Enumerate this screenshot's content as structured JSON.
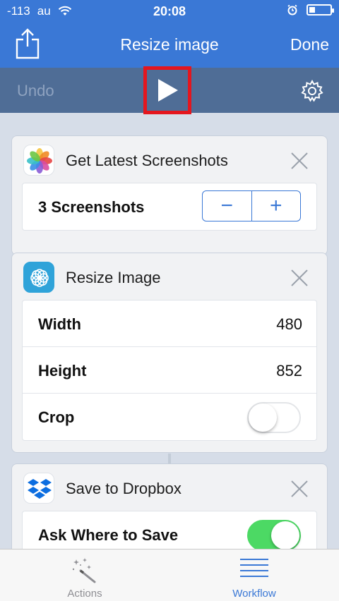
{
  "status_bar": {
    "signal": "-113",
    "carrier": "au",
    "time": "20:08"
  },
  "nav": {
    "title": "Resize image",
    "done_label": "Done"
  },
  "toolbar": {
    "undo_label": "Undo"
  },
  "actions": [
    {
      "title": "Get Latest Screenshots",
      "icon": "photos-icon",
      "rows": [
        {
          "label": "3 Screenshots",
          "control": "stepper"
        }
      ]
    },
    {
      "title": "Resize Image",
      "icon": "resize-image-icon",
      "rows": [
        {
          "label": "Width",
          "value": "480"
        },
        {
          "label": "Height",
          "value": "852"
        },
        {
          "label": "Crop",
          "control": "toggle",
          "on": false
        }
      ]
    },
    {
      "title": "Save to Dropbox",
      "icon": "dropbox-icon",
      "rows": [
        {
          "label": "Ask Where to Save",
          "control": "toggle",
          "on": true
        }
      ]
    }
  ],
  "stepper": {
    "minus": "−",
    "plus": "+"
  },
  "tabs": [
    {
      "label": "Actions",
      "icon": "magic-wand-icon",
      "active": false
    },
    {
      "label": "Workflow",
      "icon": "list-icon",
      "active": true
    }
  ],
  "colors": {
    "accent": "#3a78d6",
    "toolbar": "#4f6d96",
    "highlight": "#e4161e",
    "toggle_on": "#4cd964"
  }
}
